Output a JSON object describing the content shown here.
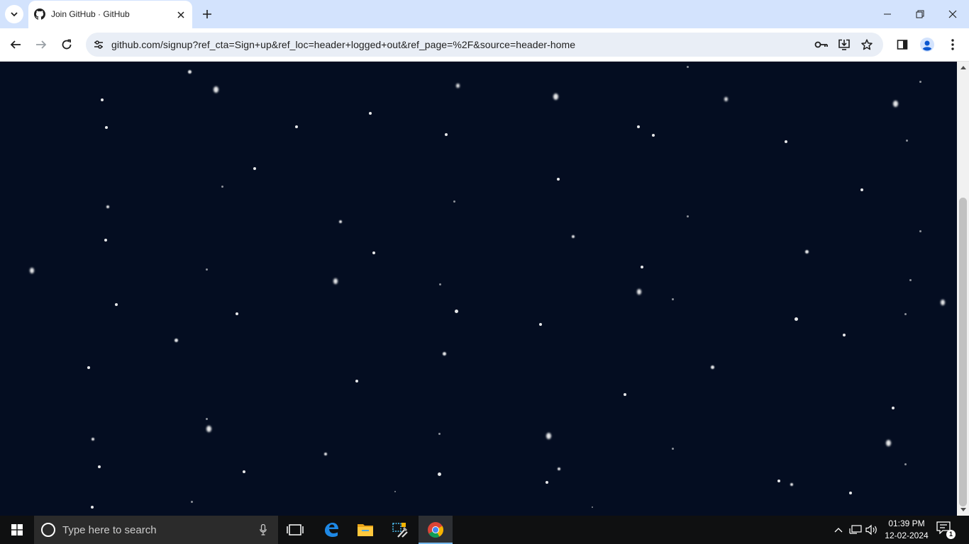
{
  "browser": {
    "tab": {
      "title": "Join GitHub · GitHub",
      "favicon": "github-icon"
    },
    "address_bar": {
      "url": "github.com/signup?ref_cta=Sign+up&ref_loc=header+logged+out&ref_page=%2F&source=header-home"
    }
  },
  "page": {
    "background": "#040d21"
  },
  "taskbar": {
    "search_placeholder": "Type here to search",
    "clock_time": "01:39 PM",
    "clock_date": "12-02-2024",
    "notification_count": "1"
  }
}
